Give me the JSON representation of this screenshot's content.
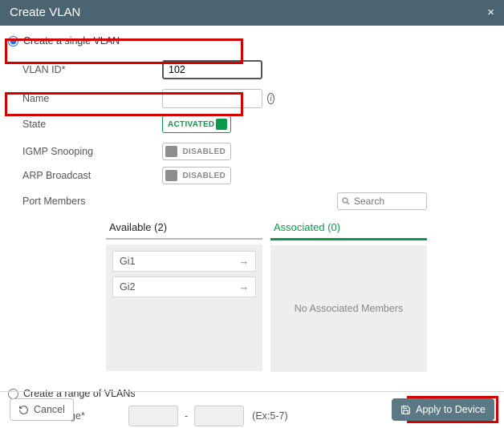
{
  "header": {
    "title": "Create VLAN",
    "close": "×"
  },
  "option_single": {
    "label": "Create a single VLAN",
    "checked": true
  },
  "single": {
    "vlan_id_label": "VLAN ID*",
    "vlan_id_value": "102",
    "name_label": "Name",
    "name_value": "",
    "state_label": "State",
    "state_value": "ACTIVATED",
    "igmp_label": "IGMP Snooping",
    "igmp_value": "DISABLED",
    "arp_label": "ARP Broadcast",
    "arp_value": "DISABLED",
    "port_members_label": "Port Members",
    "search_placeholder": "Search"
  },
  "dual": {
    "available_label": "Available (2)",
    "available_items": [
      {
        "name": "Gi1"
      },
      {
        "name": "Gi2"
      }
    ],
    "associated_label": "Associated (0)",
    "no_associated": "No Associated Members"
  },
  "option_range": {
    "label": "Create a range of VLANs",
    "checked": false
  },
  "range": {
    "label": "VLAN Range*",
    "from": "",
    "to": "",
    "example": "(Ex:5-7)"
  },
  "footer": {
    "cancel": "Cancel",
    "apply": "Apply to Device"
  }
}
